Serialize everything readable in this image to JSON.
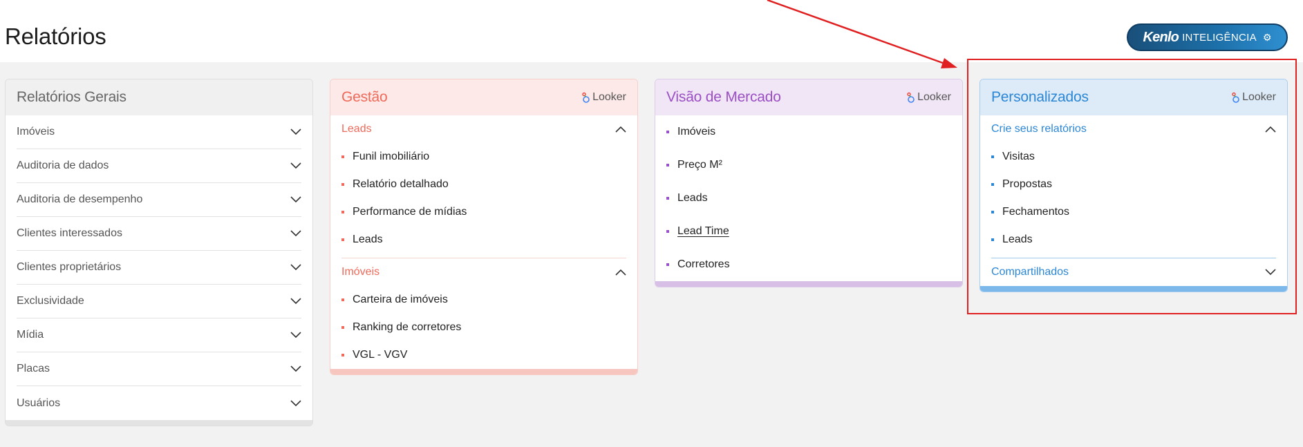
{
  "page": {
    "title": "Relatórios"
  },
  "kenlo": {
    "logo": "Kenlo",
    "label": "INTELIGÊNCIA",
    "icon": "gear-icon"
  },
  "colors": {
    "gestao": "#ef6a5a",
    "mercado": "#9b4fc4",
    "personalizados": "#2b87d6",
    "annotation": "#e02020"
  },
  "cards": {
    "gerais": {
      "title": "Relatórios Gerais",
      "items": [
        "Imóveis",
        "Auditoria de dados",
        "Auditoria de desempenho",
        "Clientes interessados",
        "Clientes proprietários",
        "Exclusividade",
        "Mídia",
        "Placas",
        "Usuários"
      ]
    },
    "gestao": {
      "title": "Gestão",
      "looker": "Looker",
      "sections": [
        {
          "label": "Leads",
          "items": [
            "Funil imobiliário",
            "Relatório detalhado",
            "Performance de mídias",
            "Leads"
          ]
        },
        {
          "label": "Imóveis",
          "items": [
            "Carteira de imóveis",
            "Ranking de corretores",
            "VGL - VGV"
          ]
        }
      ]
    },
    "mercado": {
      "title": "Visão de Mercado",
      "looker": "Looker",
      "items": [
        "Imóveis",
        "Preço M²",
        "Leads",
        "Lead Time",
        "Corretores"
      ]
    },
    "personalizados": {
      "title": "Personalizados",
      "looker": "Looker",
      "sections": [
        {
          "label": "Crie seus relatórios",
          "items": [
            "Visitas",
            "Propostas",
            "Fechamentos",
            "Leads"
          ]
        },
        {
          "label": "Compartilhados",
          "items": []
        }
      ]
    }
  }
}
